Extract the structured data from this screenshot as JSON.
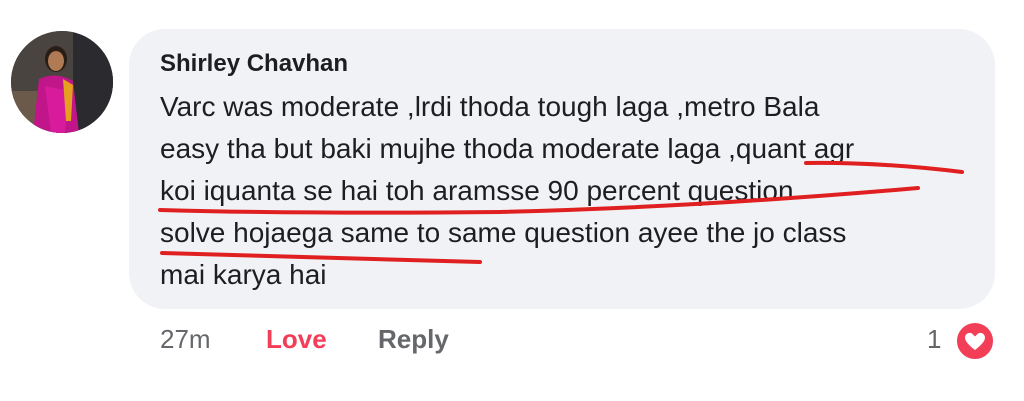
{
  "comment": {
    "author": "Shirley Chavhan",
    "lines": [
      "Varc was moderate ,lrdi thoda tough laga ,metro Bala",
      "easy tha but baki mujhe thoda moderate laga ,quant agr",
      "koi iquanta se hai toh aramsse 90 percent question",
      "solve hojaega same to same question ayee the jo class",
      "mai karya hai"
    ],
    "time": "27m",
    "love_label": "Love",
    "reply_label": "Reply",
    "reaction_count": "1"
  },
  "colors": {
    "bubble": "#f0f2f5",
    "love": "#f33e58",
    "annotation": "#e02020"
  }
}
